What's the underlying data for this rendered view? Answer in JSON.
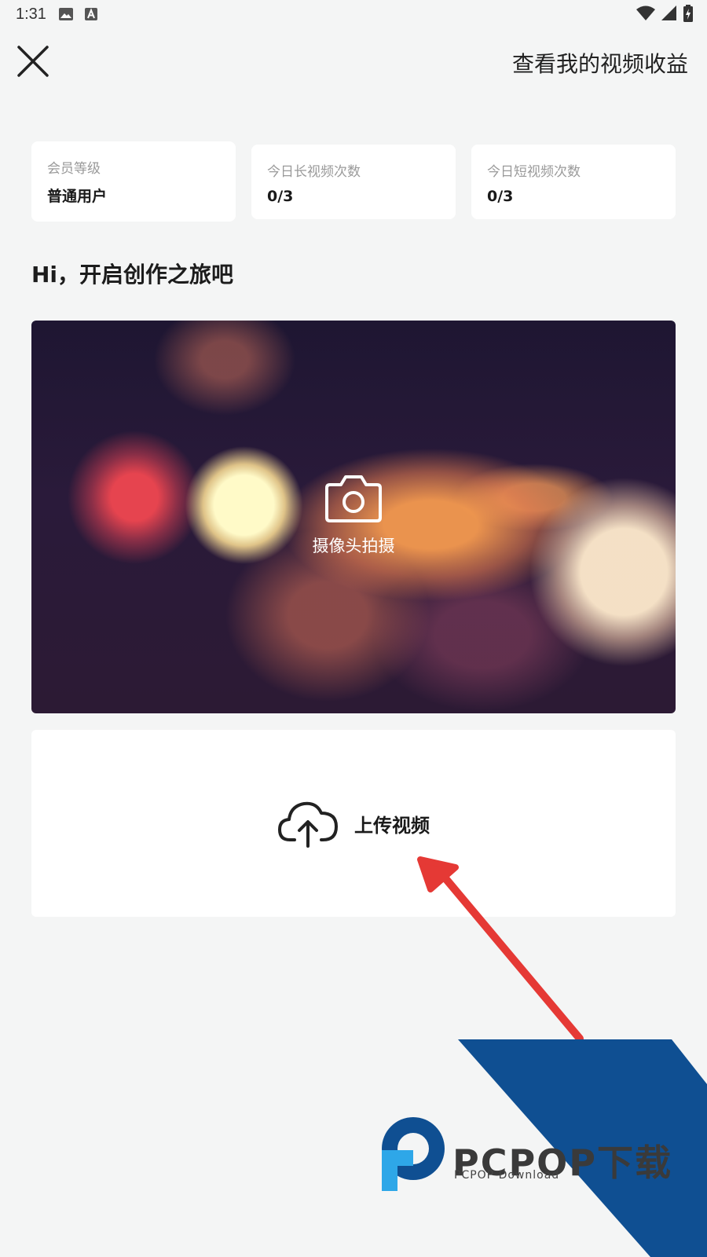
{
  "status_bar": {
    "time": "1:31"
  },
  "header": {
    "close_icon": "close-icon",
    "earnings_link": "查看我的视频收益"
  },
  "stats": [
    {
      "label": "会员等级",
      "value": "普通用户"
    },
    {
      "label": "今日长视频次数",
      "value": "0/3"
    },
    {
      "label": "今日短视频次数",
      "value": "0/3"
    }
  ],
  "greeting": "Hi，开启创作之旅吧",
  "camera": {
    "icon": "camera-icon",
    "label": "摄像头拍摄"
  },
  "upload": {
    "icon": "cloud-upload-icon",
    "label": "上传视频"
  },
  "annotation": {
    "arrow_color": "#e53935"
  },
  "watermark": {
    "brand": "PCPOP下载",
    "sub": "PCPOP Download",
    "colors": {
      "blue": "#0f4f92",
      "light_blue": "#2ea7e8",
      "text": "#3a3a3a"
    }
  }
}
